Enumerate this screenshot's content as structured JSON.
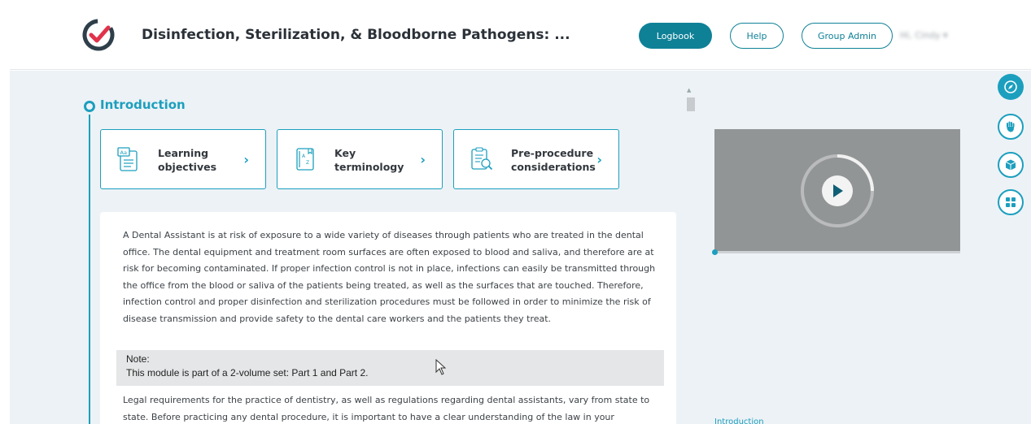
{
  "header": {
    "title": "Disinfection, Sterilization, & Bloodborne Pathogens: ...",
    "logbook_label": "Logbook",
    "help_label": "Help",
    "group_admin_label": "Group Admin",
    "user_name": "Hi, Cindy ▾"
  },
  "section": {
    "title": "Introduction"
  },
  "cards": [
    {
      "line1": "Learning",
      "line2": "objectives",
      "icon": "abc-document-icon"
    },
    {
      "line1": "Key",
      "line2": "terminology",
      "icon": "dictionary-icon"
    },
    {
      "line1": "Pre-procedure",
      "line2": "considerations",
      "icon": "checklist-search-icon"
    }
  ],
  "body": {
    "paragraph1": "A Dental Assistant is at risk of exposure to a wide variety of diseases through patients who are treated in the dental office. The dental equipment and treatment room surfaces are often exposed to blood and saliva, and therefore are at risk for becoming contaminated. If proper infection control is not in place, infections can easily be transmitted through the office from the blood or saliva of the patients being treated, as well as the surfaces that are touched. Therefore, infection control and proper disinfection and sterilization procedures must be followed in order to minimize the risk of disease transmission and provide safety to the dental care workers and the patients they treat.",
    "note_label": "Note:",
    "note_text": "This module is part of a 2-volume set: Part 1 and Part 2.",
    "paragraph2": "Legal requirements for the practice of dentistry, as well as regulations regarding dental assistants, vary from state to state. Before practicing any dental procedure, it is important to have a clear understanding of the law in your"
  },
  "side_panel": {
    "intro_link": "Introduction"
  },
  "colors": {
    "accent": "#1c9fbe",
    "logbook": "#0f8197",
    "background": "#edf2f6"
  }
}
